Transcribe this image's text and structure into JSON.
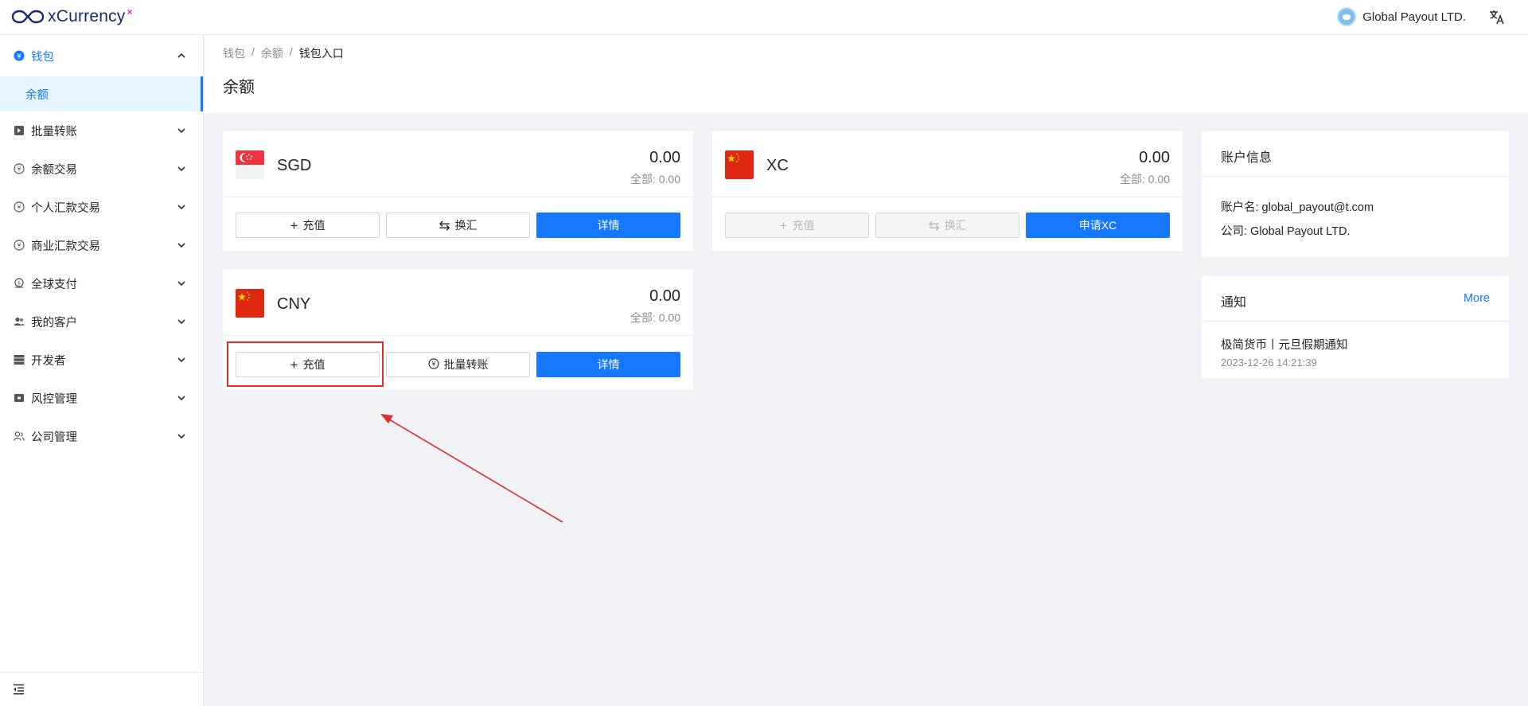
{
  "brand": {
    "name": "xCurrency",
    "mark": "×"
  },
  "header": {
    "company": "Global Payout LTD.",
    "lang_icon": "translate-icon"
  },
  "sidebar": {
    "items": [
      {
        "label": "钱包",
        "icon": "wallet-icon",
        "expanded": true,
        "active": true
      },
      {
        "label": "批量转账",
        "icon": "batch-transfer-icon"
      },
      {
        "label": "余额交易",
        "icon": "balance-trade-icon"
      },
      {
        "label": "个人汇款交易",
        "icon": "personal-remit-icon"
      },
      {
        "label": "商业汇款交易",
        "icon": "business-remit-icon"
      },
      {
        "label": "全球支付",
        "icon": "global-pay-icon"
      },
      {
        "label": "我的客户",
        "icon": "customers-icon"
      },
      {
        "label": "开发者",
        "icon": "developer-icon"
      },
      {
        "label": "风控管理",
        "icon": "risk-icon"
      },
      {
        "label": "公司管理",
        "icon": "company-icon"
      }
    ],
    "submenu": {
      "label": "余额"
    }
  },
  "breadcrumb": {
    "item1": "钱包",
    "item2": "余额",
    "item3": "钱包入口",
    "sep": "/"
  },
  "page": {
    "title": "余额"
  },
  "cards": {
    "sgd": {
      "code": "SGD",
      "amount": "0.00",
      "total": "全部: 0.00",
      "btn1": "充值",
      "btn2": "换汇",
      "btn3": "详情"
    },
    "xc": {
      "code": "XC",
      "amount": "0.00",
      "total": "全部: 0.00",
      "btn1": "充值",
      "btn2": "换汇",
      "btn3": "申请XC"
    },
    "cny": {
      "code": "CNY",
      "amount": "0.00",
      "total": "全部: 0.00",
      "btn1": "充值",
      "btn2": "批量转账",
      "btn3": "详情"
    }
  },
  "account_info": {
    "title": "账户信息",
    "account_name": "账户名: global_payout@t.com",
    "company": "公司: Global Payout LTD."
  },
  "notice": {
    "title": "通知",
    "more": "More",
    "item_title": "极简货币丨元旦假期通知",
    "item_date": "2023-12-26 14:21:39"
  },
  "colors": {
    "primary": "#1677ff",
    "highlight": "#e02d2d",
    "background": "#f0f2f5"
  }
}
